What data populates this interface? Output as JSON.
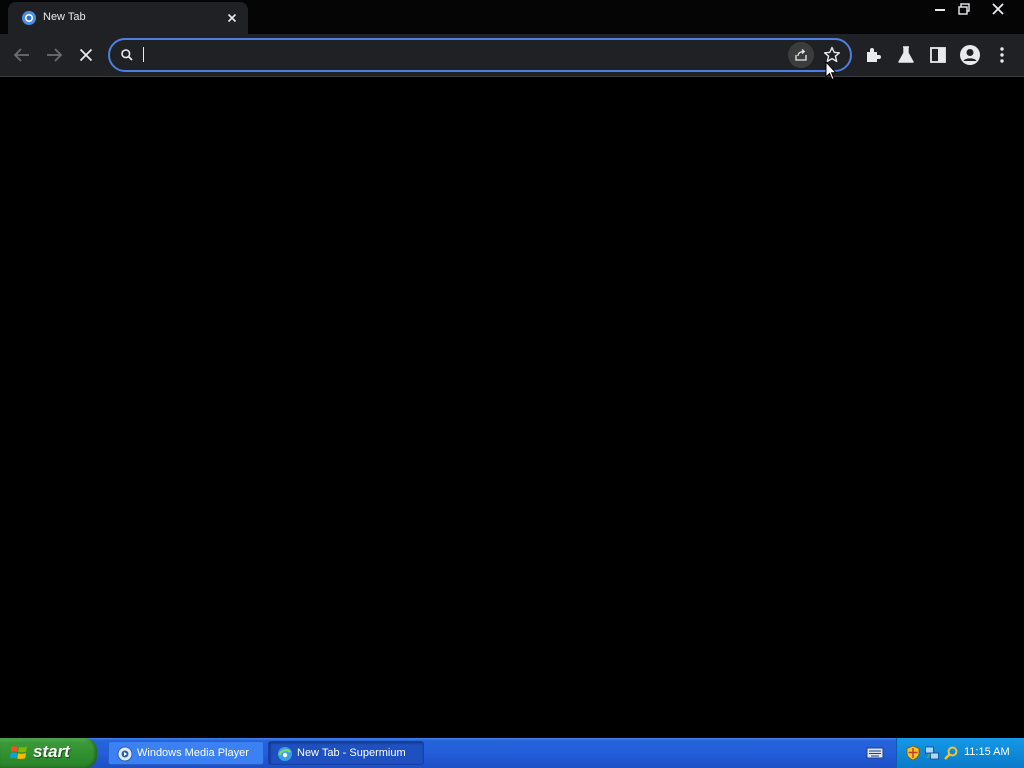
{
  "browser": {
    "tab": {
      "title": "New Tab",
      "favicon": "supermium-logo-icon",
      "close_icon": "close-icon"
    },
    "window_controls": {
      "minimize_icon": "minimize-icon",
      "restore_icon": "restore-icon",
      "close_icon": "close-icon"
    },
    "toolbar": {
      "back_icon": "back-arrow-icon",
      "forward_icon": "forward-arrow-icon",
      "stop_icon": "stop-loading-icon",
      "extensions_icon": "puzzle-icon",
      "labs_icon": "flask-icon",
      "side_panel_icon": "side-panel-icon",
      "profile_icon": "profile-icon",
      "menu_icon": "three-dot-menu-icon"
    },
    "omnibox": {
      "value": "",
      "placeholder": "",
      "search_icon": "search-icon",
      "share_icon": "share-icon",
      "bookmark_icon": "star-icon"
    }
  },
  "taskbar": {
    "start_label": "start",
    "tasks": [
      {
        "label": "Windows Media Player",
        "icon": "windows-media-player-icon",
        "active": false
      },
      {
        "label": "New Tab - Supermium",
        "icon": "supermium-logo-icon",
        "active": true
      }
    ],
    "tray": {
      "icons": [
        "keyboard-icon",
        "security-shield-icon",
        "network-icon",
        "search-magnifier-icon"
      ],
      "clock": "11:15 AM"
    }
  },
  "colors": {
    "focus_ring": "#4d7fe0",
    "toolbar_bg": "#202124",
    "taskbar_blue": "#245edb",
    "start_green": "#3a9a3a",
    "tray_blue": "#0e8ad8"
  }
}
